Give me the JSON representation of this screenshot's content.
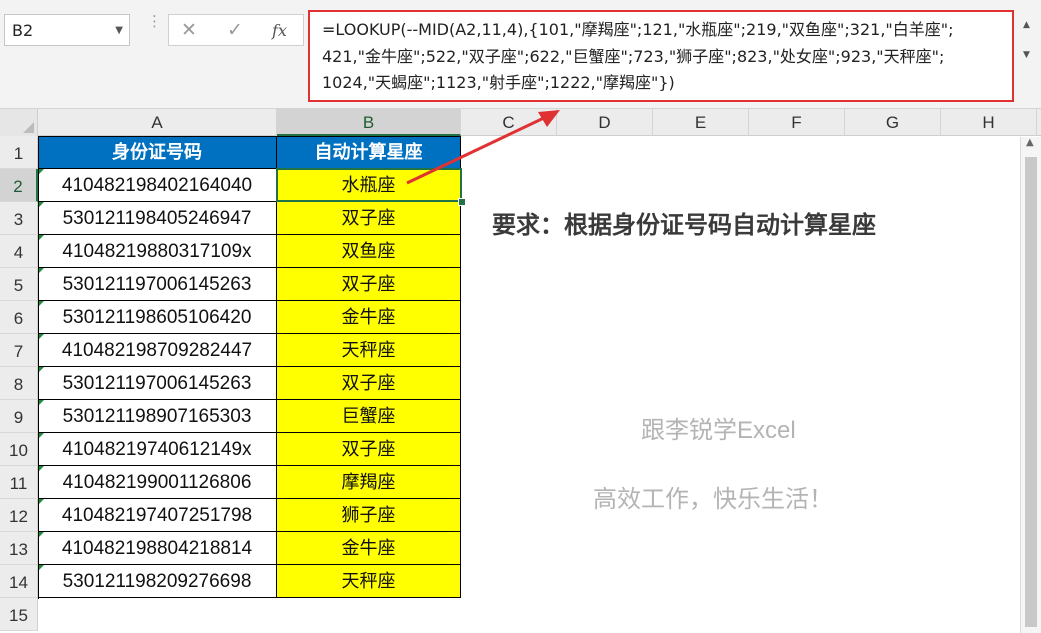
{
  "name_box": {
    "value": "B2"
  },
  "formula_bar": {
    "cancel_glyph": "✕",
    "enter_glyph": "✓",
    "fx_label": "fx",
    "lines": [
      "=LOOKUP(--MID(A2,11,4),{101,\"摩羯座\";121,\"水瓶座\";219,\"双鱼座\";321,\"白羊座\";",
      "421,\"金牛座\";522,\"双子座\";622,\"巨蟹座\";723,\"狮子座\";823,\"处女座\";923,\"天秤座\";",
      "1024,\"天蝎座\";1123,\"射手座\";1222,\"摩羯座\"})"
    ]
  },
  "columns": [
    "A",
    "B",
    "C",
    "D",
    "E",
    "F",
    "G",
    "H"
  ],
  "rows": [
    "1",
    "2",
    "3",
    "4",
    "5",
    "6",
    "7",
    "8",
    "9",
    "10",
    "11",
    "12",
    "13",
    "14",
    "15"
  ],
  "table": {
    "headers": [
      "身份证号码",
      "自动计算星座"
    ],
    "rows": [
      {
        "id": "410482198402164040",
        "zodiac": "水瓶座"
      },
      {
        "id": "530121198405246947",
        "zodiac": "双子座"
      },
      {
        "id": "41048219880317109x",
        "zodiac": "双鱼座"
      },
      {
        "id": "530121197006145263",
        "zodiac": "双子座"
      },
      {
        "id": "530121198605106420",
        "zodiac": "金牛座"
      },
      {
        "id": "410482198709282447",
        "zodiac": "天秤座"
      },
      {
        "id": "530121197006145263",
        "zodiac": "双子座"
      },
      {
        "id": "530121198907165303",
        "zodiac": "巨蟹座"
      },
      {
        "id": "41048219740612149x",
        "zodiac": "双子座"
      },
      {
        "id": "410482199001126806",
        "zodiac": "摩羯座"
      },
      {
        "id": "410482197407251798",
        "zodiac": "狮子座"
      },
      {
        "id": "410482198804218814",
        "zodiac": "金牛座"
      },
      {
        "id": "530121198209276698",
        "zodiac": "天秤座"
      }
    ]
  },
  "requirement_text": "要求：根据身份证号码自动计算星座",
  "watermark": {
    "line1": "跟李锐学Excel",
    "line2": "高效工作，快乐生活！"
  },
  "colors": {
    "header_fill": "#0070c0",
    "zodiac_fill": "#ffff00",
    "annotation": "#e03232",
    "selection": "#217346"
  }
}
